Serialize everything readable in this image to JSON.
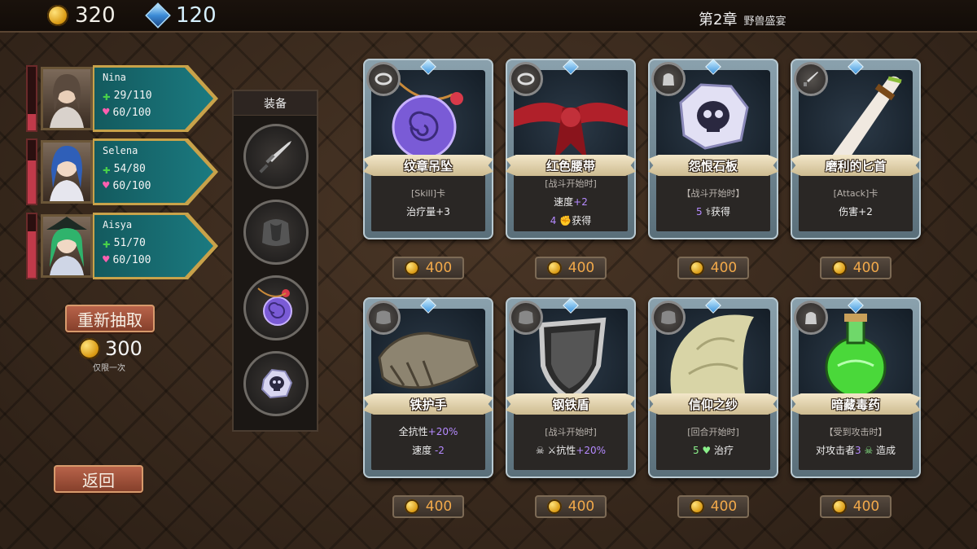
{
  "resources": {
    "gold": "320",
    "gems": "120"
  },
  "chapter": {
    "title": "第2章",
    "subtitle": "野兽盛宴"
  },
  "party": [
    {
      "name": "Nina",
      "hp": "29/110",
      "sp": "60/100",
      "hp_fraction": 0.26
    },
    {
      "name": "Selena",
      "hp": "54/80",
      "sp": "60/100",
      "hp_fraction": 0.68
    },
    {
      "name": "Aisya",
      "hp": "51/70",
      "sp": "60/100",
      "hp_fraction": 0.73
    }
  ],
  "reroll": {
    "label": "重新抽取",
    "cost": "300",
    "note": "仅限一次"
  },
  "back_label": "返回",
  "equipment": {
    "title": "装备",
    "slots": [
      "dagger-icon",
      "armor-icon",
      "amulet-icon",
      "skull-stone-icon"
    ]
  },
  "cards": [
    {
      "name": "纹章吊坠",
      "type_icon": "ring-icon",
      "line1": "[Skill]卡",
      "line2": "治疗量",
      "line2_value": "+3",
      "price": "400"
    },
    {
      "name": "红色腰带",
      "type_icon": "ring-icon",
      "line1": "[战斗开始时]",
      "line2": "速度",
      "line2_value": "+2",
      "line3_num": "4",
      "line3": "获得",
      "price": "400"
    },
    {
      "name": "怨恨石板",
      "type_icon": "bag-icon",
      "line1": "【战斗开始时】",
      "line2_num": "5",
      "line2": "获得",
      "price": "400"
    },
    {
      "name": "磨利的匕首",
      "type_icon": "dagger-icon",
      "line1": "[Attack]卡",
      "line2": "伤害+2",
      "price": "400"
    },
    {
      "name": "铁护手",
      "type_icon": "armor-icon",
      "line1": "全抗性",
      "line1_value": "+20%",
      "line2": "速度",
      "line2_value": "-2",
      "price": "400"
    },
    {
      "name": "钢铁盾",
      "type_icon": "armor-icon",
      "line1": "[战斗开始时]",
      "line2": "抗性",
      "line2_value": "+20%",
      "price": "400"
    },
    {
      "name": "信仰之纱",
      "type_icon": "armor-icon",
      "line1": "[回合开始时]",
      "line2_num": "5",
      "line2": "治疗",
      "price": "400"
    },
    {
      "name": "暗藏毒药",
      "type_icon": "bag-icon",
      "line1": "【受到攻击时】",
      "line2_pre": "对攻击者",
      "line2_num": "3",
      "line2": "造成",
      "price": "400"
    }
  ]
}
